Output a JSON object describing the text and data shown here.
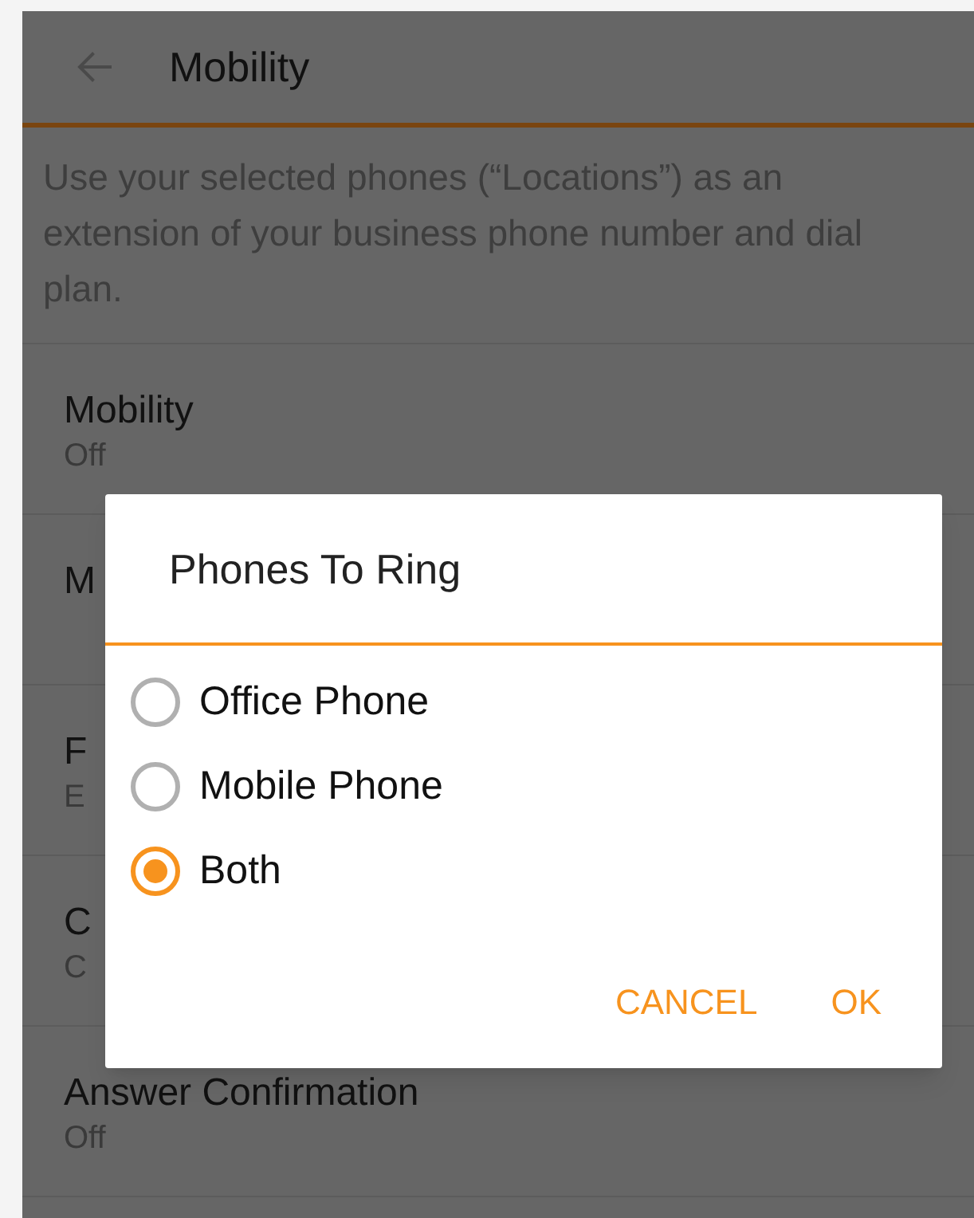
{
  "header": {
    "title": "Mobility"
  },
  "description": "Use your selected phones (“Locations”) as an extension of your business phone number and dial plan.",
  "settings": [
    {
      "title": "Mobility",
      "value": "Off"
    },
    {
      "title": "M"
    },
    {
      "title": "F",
      "value": "E"
    },
    {
      "title": "C",
      "value": "C"
    },
    {
      "title": "Answer Confirmation",
      "value": "Off"
    }
  ],
  "dialog": {
    "title": "Phones To Ring",
    "options": [
      {
        "label": "Office Phone",
        "selected": false
      },
      {
        "label": "Mobile Phone",
        "selected": false
      },
      {
        "label": "Both",
        "selected": true
      }
    ],
    "buttons": [
      {
        "label": "CANCEL"
      },
      {
        "label": "OK"
      }
    ]
  }
}
